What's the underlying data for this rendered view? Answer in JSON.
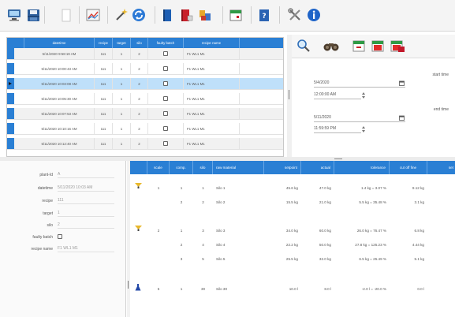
{
  "toolbar": {
    "icons": [
      "monitor-icon",
      "save-icon",
      "blank-document-icon",
      "chart-icon",
      "magic-wand-icon",
      "refresh-icon",
      "book-blue-icon",
      "book-red-icon",
      "tools-box-icon",
      "calendar-icon",
      "help-book-icon",
      "wrench-screwdriver-icon",
      "info-icon"
    ]
  },
  "batch_table": {
    "columns": [
      "datetime",
      "recipe",
      "target",
      "silo",
      "faulty batch",
      "recipe name"
    ],
    "rows": [
      {
        "datetime": "5/11/2020 9:58:19 AM",
        "recipe": "111",
        "target": "1",
        "silo": "2",
        "faulty_batch": false,
        "recipe_name": "F1 WL1 M1",
        "selected": false
      },
      {
        "datetime": "5/11/2020 10:00:43 AM",
        "recipe": "111",
        "target": "1",
        "silo": "2",
        "faulty_batch": false,
        "recipe_name": "F1 WL1 M1",
        "selected": false
      },
      {
        "datetime": "5/11/2020 10:03:08 AM",
        "recipe": "111",
        "target": "1",
        "silo": "2",
        "faulty_batch": false,
        "recipe_name": "F1 WL1 M1",
        "selected": true
      },
      {
        "datetime": "5/11/2020 10:05:30 AM",
        "recipe": "111",
        "target": "1",
        "silo": "2",
        "faulty_batch": false,
        "recipe_name": "F1 WL1 M1",
        "selected": false
      },
      {
        "datetime": "5/11/2020 10:07:53 AM",
        "recipe": "111",
        "target": "1",
        "silo": "2",
        "faulty_batch": false,
        "recipe_name": "F1 WL1 M1",
        "selected": false
      },
      {
        "datetime": "5/11/2020 10:10:16 AM",
        "recipe": "111",
        "target": "1",
        "silo": "2",
        "faulty_batch": false,
        "recipe_name": "F1 WL1 M1",
        "selected": false
      },
      {
        "datetime": "5/11/2020 10:12:40 AM",
        "recipe": "111",
        "target": "1",
        "silo": "2",
        "faulty_batch": false,
        "recipe_name": "F1 WL1 M1",
        "selected": false
      }
    ]
  },
  "filter": {
    "tool_icons": [
      "magnifier-icon",
      "binoculars-icon",
      "calendar-minus-icon",
      "calendar-red-icon",
      "calendar-red-stack-icon"
    ],
    "start_label": "start time",
    "start_date": "5/4/2020",
    "start_time": "12:00:00 AM",
    "end_label": "end time",
    "end_date": "5/11/2020",
    "end_time": "11:59:59 PM"
  },
  "detail": {
    "fields": [
      {
        "label": "plant-Id",
        "value": "A"
      },
      {
        "label": "datetime",
        "value": "5/11/2020 10:03 AM"
      },
      {
        "label": "recipe",
        "value": "111"
      },
      {
        "label": "target",
        "value": "1"
      },
      {
        "label": "silo",
        "value": "2"
      },
      {
        "label": "faulty batch",
        "value": ""
      },
      {
        "label": "recipe name",
        "value": "F1 WL1 M1"
      }
    ]
  },
  "component_table": {
    "columns": [
      "scale",
      "comp.",
      "silo",
      "raw material",
      "setpoint",
      "actual",
      "tolerance",
      "cut off fine",
      "set"
    ],
    "rows": [
      {
        "icon": "scale-yellow-icon",
        "scale": "1",
        "comp": "1",
        "silo": "1",
        "raw_material": "Silo 1",
        "setpoint": "45.6 kg",
        "actual": "47.0 kg",
        "tolerance": "1.4 kg = 3.07 %",
        "cut_off_fine": "9.12 kg"
      },
      {
        "icon": "",
        "scale": "",
        "comp": "2",
        "silo": "2",
        "raw_material": "Silo 2",
        "setpoint": "15.5 kg",
        "actual": "21.0 kg",
        "tolerance": "5.5 kg = 35.48 %",
        "cut_off_fine": "3.1 kg"
      },
      {
        "icon": "scale-yellow-icon",
        "scale": "2",
        "comp": "1",
        "silo": "3",
        "raw_material": "Silo 3",
        "setpoint": "34.0 kg",
        "actual": "60.0 kg",
        "tolerance": "26.0 kg = 76.47 %",
        "cut_off_fine": "6.8 kg"
      },
      {
        "icon": "",
        "scale": "",
        "comp": "2",
        "silo": "4",
        "raw_material": "Silo 4",
        "setpoint": "22.2 kg",
        "actual": "50.0 kg",
        "tolerance": "27.8 kg = 125.23 %",
        "cut_off_fine": "4.44 kg"
      },
      {
        "icon": "",
        "scale": "",
        "comp": "3",
        "silo": "5",
        "raw_material": "Silo 5",
        "setpoint": "25.5 kg",
        "actual": "32.0 kg",
        "tolerance": "6.5 kg = 25.49 %",
        "cut_off_fine": "5.1 kg"
      },
      {
        "icon": "flask-blue-icon",
        "scale": "5",
        "comp": "1",
        "silo": "30",
        "raw_material": "Silo 30",
        "setpoint": "10.0 l",
        "actual": "8.0 l",
        "tolerance": "-2.0 l = -20.0 %",
        "cut_off_fine": "0.0 l"
      }
    ]
  }
}
